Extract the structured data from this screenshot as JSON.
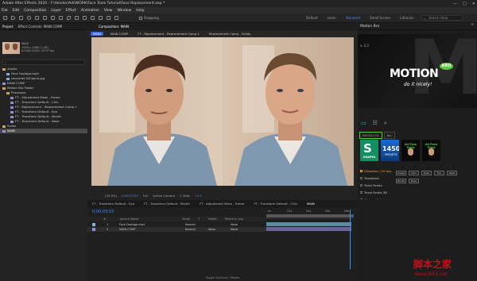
{
  "window": {
    "title": "Adobe After Effects 2020 - F:\\Vendor\\Adi\\WORK\\Face Tools Tutorial\\Face Replacement.aep *",
    "controls": [
      "—",
      "□",
      "✕"
    ]
  },
  "menu": [
    "File",
    "Edit",
    "Composition",
    "Layer",
    "Effect",
    "Animation",
    "View",
    "Window",
    "Help"
  ],
  "toolbar": {
    "snapping_label": "Snapping",
    "workspaces": [
      "Default",
      "Learn",
      "Standard",
      "Small Screen",
      "Libraries"
    ],
    "active_workspace": "Standard",
    "search_placeholder": "Search Help"
  },
  "project": {
    "tabs": [
      "Project",
      "Effect Controls: MAIN COMP"
    ],
    "selected_tab": "Project",
    "selected_item": {
      "name": "MAIN",
      "line1": "1920 x 1080 (1.00)",
      "line2": "Δ 0;00;10;00, 29.97 fps"
    },
    "items": [
      {
        "icon": "folder-icon",
        "label": "Assets",
        "indent": 0
      },
      {
        "icon": "footage-icon",
        "label": "Face Footage.mp4",
        "indent": 1
      },
      {
        "icon": "footage-icon",
        "label": "Leonardo DiCaprio.jpg",
        "indent": 1
      },
      {
        "icon": "comp-icon",
        "label": "MAIN COMP",
        "indent": 0
      },
      {
        "icon": "folder-icon",
        "label": "Motion Bro Folder",
        "indent": 0
      },
      {
        "icon": "folder-icon",
        "label": "Precomps",
        "indent": 1
      },
      {
        "icon": "comp-icon",
        "label": "FT - Adjustment Mask - Frame",
        "indent": 2
      },
      {
        "icon": "comp-icon",
        "label": "FT - Transform Default - Chin",
        "indent": 2
      },
      {
        "icon": "comp-icon",
        "label": "FT - Replacement - Replacement Comp 1",
        "indent": 2
      },
      {
        "icon": "comp-icon",
        "label": "FT - Transform Default - Eye",
        "indent": 2
      },
      {
        "icon": "comp-icon",
        "label": "FT - Transform Default - Mouth",
        "indent": 2
      },
      {
        "icon": "comp-icon",
        "label": "FT - Transform Default - Nose",
        "indent": 2
      },
      {
        "icon": "folder-icon",
        "label": "Solids",
        "indent": 0
      },
      {
        "icon": "comp-icon",
        "label": "MAIN",
        "indent": 0,
        "selected": true
      }
    ]
  },
  "viewer": {
    "panel_tab": "Composition: MAIN",
    "comp_tabs": [
      "MAIN",
      "MAIN COMP",
      "FT - Replacement - Replacement Comp 1",
      "Replacement Comp - Solids"
    ],
    "selected_comp_tab": "MAIN",
    "zoom": "(34.9%)",
    "timecode": "0;00;03;03",
    "resolution": "Full",
    "camera": "Active Camera",
    "views": "1 View",
    "offset": "+0.0"
  },
  "timeline": {
    "tabs": [
      "FT - Transform Default - Eye",
      "FT - Transform Default - Mouth",
      "FT - Adjustment Mask - Frame",
      "FT - Transform Default - Chin",
      "MAIN"
    ],
    "selected_tab": "MAIN",
    "timecode": "0;00;03;03",
    "columns": [
      "#",
      "Source Name",
      "Mode",
      "T",
      "TrkMat",
      "Parent & Link"
    ],
    "layers": [
      {
        "num": "1",
        "name": "Face Footage.mp4",
        "mode": "Normal",
        "parent": "None",
        "label_color": "#7fb3d1"
      },
      {
        "num": "2",
        "name": "MAIN COMP",
        "mode": "Normal",
        "trkmat": "None",
        "parent": "None",
        "label_color": "#9a8bcf"
      }
    ],
    "ruler_ticks": [
      "0s",
      "02s",
      "04s",
      "06s",
      "08s"
    ],
    "toggle_label": "Toggle Switches / Modes"
  },
  "motionbro": {
    "panel_title": "Motion Bro",
    "version": "v. 4.2",
    "logo_text": "MOTION",
    "logo_badge": "BRO",
    "tagline": "do it nicely!",
    "tabs": [
      "INSTALLED",
      "ALL"
    ],
    "selected_tab": "INSTALLED",
    "presets": [
      {
        "big": "S",
        "label": "SHAPES"
      },
      {
        "big": "1450",
        "label": "PRESETS"
      },
      {
        "label": "All Face Tools"
      },
      {
        "label": "All Face Tools"
      }
    ],
    "categories": [
      "Distortion (16 fps)",
      "Transform",
      "Track Points",
      "Track Points 3D",
      "Makeup Holder",
      "Face Replacement (beta)",
      "Adjustment Masks",
      "Blend Parts",
      "HOW-TO-USE"
    ],
    "highlighted_category": "Distortion (16 fps)",
    "buttons": [
      "Cheek",
      "Chin",
      "Eyes",
      "Full",
      "Head",
      "Mouth",
      "Nose"
    ]
  },
  "watermark": {
    "cn": "脚本之家",
    "url": "www.jb51.net"
  },
  "colors": {
    "accent_blue": "#3b8cff",
    "brand_green": "#5ccc3b",
    "watermark_red": "#c70f17",
    "highlight_orange": "#f2a03d"
  }
}
